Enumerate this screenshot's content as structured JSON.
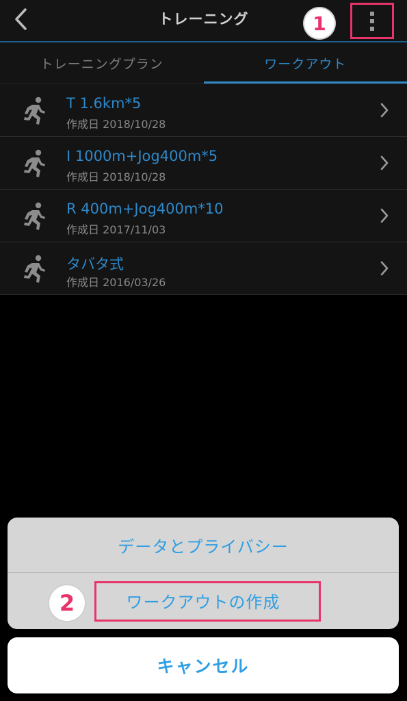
{
  "header": {
    "title": "トレーニング",
    "badge_1": "1"
  },
  "tabs": [
    {
      "label": "トレーニングプラン",
      "active": false
    },
    {
      "label": "ワークアウト",
      "active": true
    }
  ],
  "workouts": [
    {
      "name": "T 1.6km*5",
      "date": "作成日 2018/10/28"
    },
    {
      "name": "I 1000m+Jog400m*5",
      "date": "作成日 2018/10/28"
    },
    {
      "name": "R 400m+Jog400m*10",
      "date": "作成日 2017/11/03"
    },
    {
      "name": "タバタ式",
      "date": "作成日 2016/03/26"
    }
  ],
  "action_sheet": {
    "privacy_label": "データとプライバシー",
    "create_label": "ワークアウトの作成",
    "cancel_label": "キャンセル",
    "badge_2": "2"
  },
  "colors": {
    "accent": "#2f88c9",
    "highlight": "#e8336b",
    "background": "#000000"
  },
  "icons": {
    "back": "chevron-left-icon",
    "menu": "more-vertical-icon",
    "workout": "running-person-icon",
    "row_arrow": "chevron-right-icon"
  }
}
